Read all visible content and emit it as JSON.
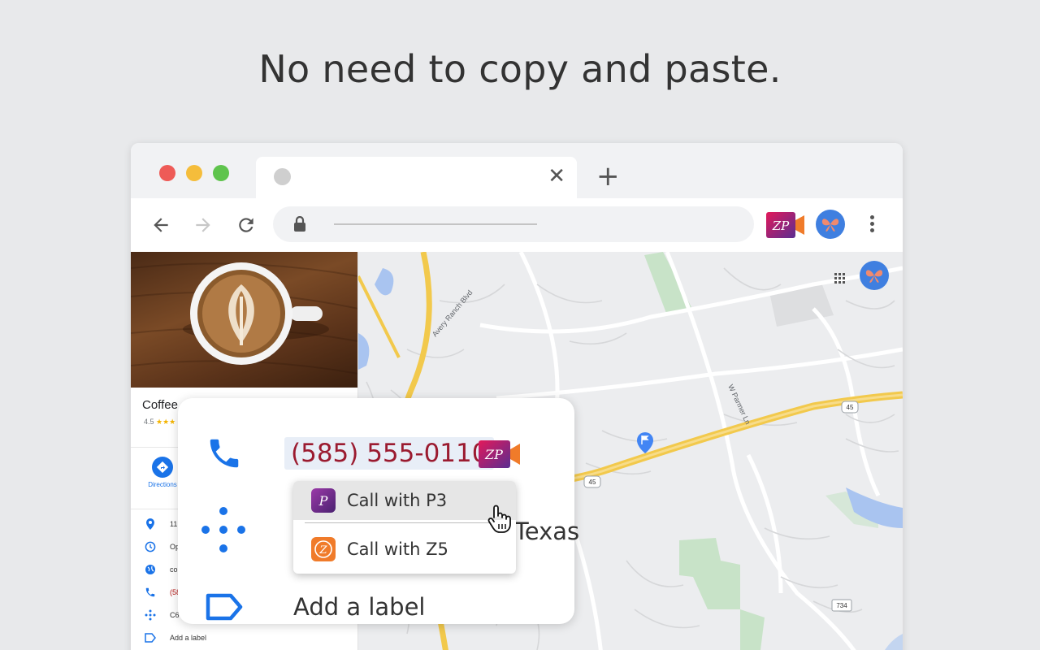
{
  "headline": "No need to copy and paste.",
  "colors": {
    "accent_blue": "#1a73e8",
    "phone_red": "#9b1b30",
    "p3_purple": "#7b2a88",
    "z5_orange": "#f07b2a",
    "zp_gradient_start": "#e3195a",
    "zp_gradient_end": "#5a2d91"
  },
  "browser": {
    "tab_close": "✕",
    "new_tab": "+",
    "extensions": {
      "zp_icon": "ZP",
      "avatar_icon": "butterfly-icon"
    }
  },
  "sidebar": {
    "title": "Coffee",
    "rating": "4.5",
    "stars": "★★★",
    "directions_label": "Directions",
    "rows": [
      {
        "icon": "location-pin-icon",
        "text": "11"
      },
      {
        "icon": "clock-icon",
        "text": "Op"
      },
      {
        "icon": "globe-icon",
        "text": "co"
      },
      {
        "icon": "phone-icon",
        "text": "(58"
      },
      {
        "icon": "plus-code-icon",
        "text": "C6"
      },
      {
        "icon": "label-icon",
        "text": "Add a label"
      }
    ]
  },
  "map": {
    "road_labels": [
      "Avery Ranch Blvd",
      "W Parmer Ln"
    ],
    "shields": [
      "45",
      "45",
      "734"
    ]
  },
  "popup": {
    "phone_number": "(585) 555-0110",
    "partial_location": "Texas",
    "add_label": "Add a label",
    "menu": [
      {
        "label": "Call with P3",
        "icon_letter": "P"
      },
      {
        "label": "Call with Z5",
        "icon_letter": "Z"
      }
    ]
  }
}
